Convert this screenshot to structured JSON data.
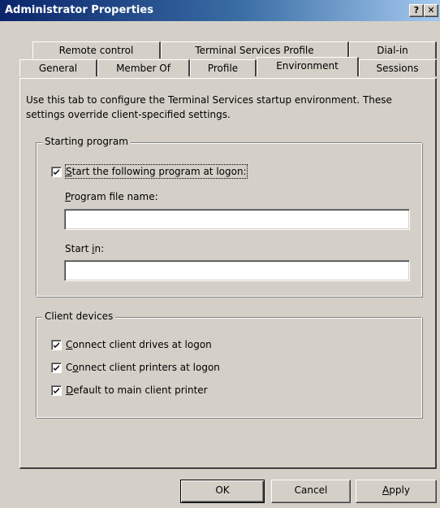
{
  "window": {
    "title": "Administrator Properties",
    "help_glyph": "?",
    "close_glyph": "✕"
  },
  "tabs": {
    "row1": [
      {
        "label": "Remote control"
      },
      {
        "label": "Terminal Services Profile"
      },
      {
        "label": "Dial-in"
      }
    ],
    "row2": [
      {
        "label": "General"
      },
      {
        "label": "Member Of"
      },
      {
        "label": "Profile"
      },
      {
        "label": "Environment",
        "active": true
      },
      {
        "label": "Sessions"
      }
    ]
  },
  "description": {
    "line1": "Use this tab to configure the Terminal Services startup environment. These",
    "line2": "settings override client-specified settings."
  },
  "starting_program": {
    "title": "Starting program",
    "start_checkbox": {
      "prefix": "",
      "accel": "S",
      "rest": "tart the following program at logon:",
      "checked": true
    },
    "program_file": {
      "prefix": "",
      "accel": "P",
      "rest": "rogram file name:",
      "value": ""
    },
    "start_in": {
      "prefix": "Start ",
      "accel": "i",
      "rest": "n:",
      "value": ""
    }
  },
  "client_devices": {
    "title": "Client devices",
    "items": [
      {
        "prefix": "",
        "accel": "C",
        "rest": "onnect client drives at logon",
        "checked": true
      },
      {
        "prefix": "C",
        "accel": "o",
        "rest": "nnect client printers at logon",
        "checked": true
      },
      {
        "prefix": "",
        "accel": "D",
        "rest": "efault to main client printer",
        "checked": true
      }
    ]
  },
  "buttons": {
    "ok": "OK",
    "cancel": "Cancel",
    "apply_accel": "A",
    "apply_rest": "pply"
  },
  "colors": {
    "face": "#d4d0c8",
    "title_start": "#0a246a",
    "title_end": "#a6caf0"
  },
  "icons": [
    "help-icon",
    "close-icon",
    "checkmark-icon"
  ]
}
